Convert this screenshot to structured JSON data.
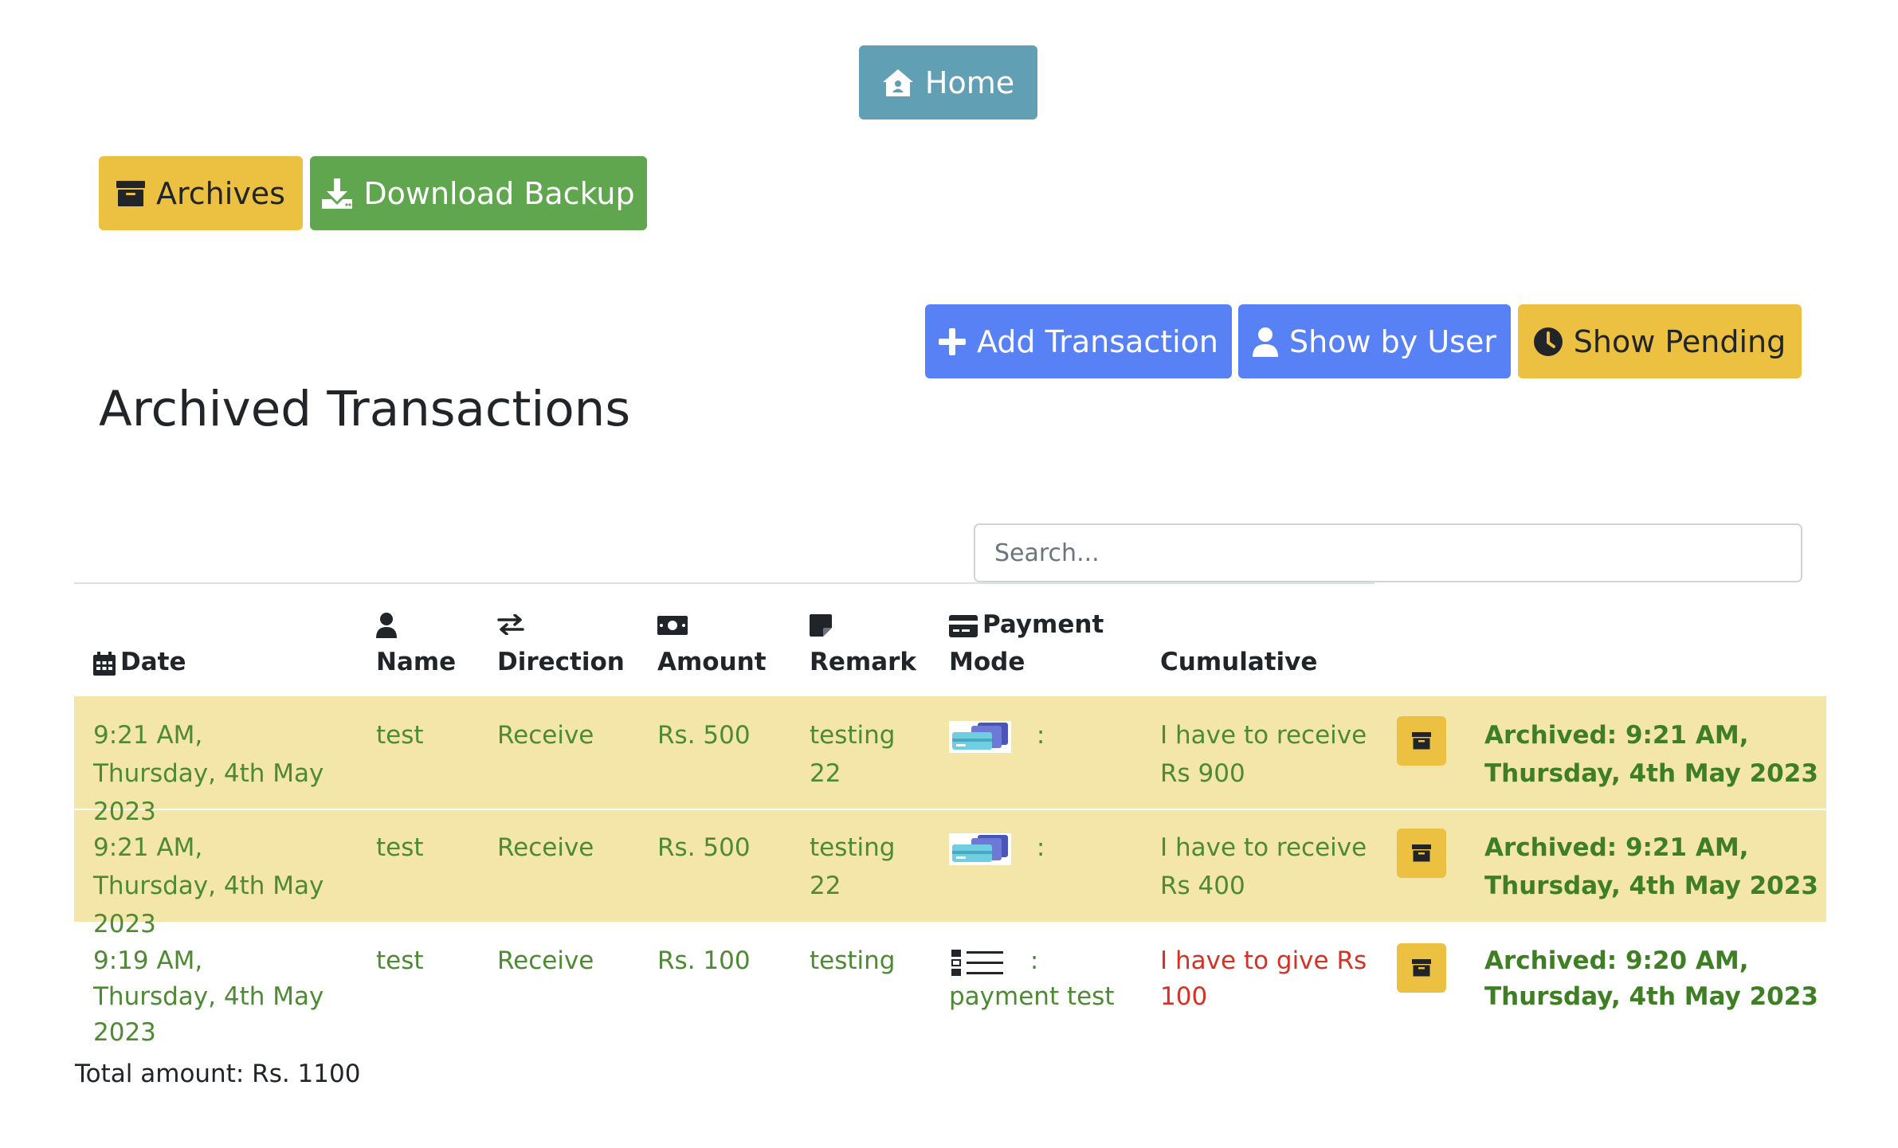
{
  "nav": {
    "home_label": "Home"
  },
  "top_actions": {
    "archives_label": "Archives",
    "backup_label": "Download Backup"
  },
  "actions": {
    "add_label": "Add Transaction",
    "by_user_label": "Show by User",
    "pending_label": "Show Pending"
  },
  "page_title": "Archived Transactions",
  "search": {
    "placeholder": "Search..."
  },
  "columns": {
    "date": "Date",
    "name": "Name",
    "direction": "Direction",
    "amount": "Amount",
    "remark": "Remark",
    "payment_mode": "Payment Mode",
    "cumulative": "Cumulative"
  },
  "rows": [
    {
      "date": "9:21 AM, Thursday, 4th May 2023",
      "name": "test",
      "direction": "Receive",
      "amount": "Rs. 500",
      "remark": "testing 22",
      "payment_icon": "card-icon",
      "payment_sep": ":",
      "payment_note": "",
      "cumulative": "I have to receive Rs 900",
      "cumulative_color": "#4e8a34",
      "archived": "Archived: 9:21 AM, Thursday, 4th May 2023"
    },
    {
      "date": "9:21 AM, Thursday, 4th May 2023",
      "name": "test",
      "direction": "Receive",
      "amount": "Rs. 500",
      "remark": "testing 22",
      "payment_icon": "card-icon",
      "payment_sep": ":",
      "payment_note": "",
      "cumulative": "I have to receive Rs 400",
      "cumulative_color": "#4e8a34",
      "archived": "Archived: 9:21 AM, Thursday, 4th May 2023"
    },
    {
      "date": "9:19 AM, Thursday, 4th May 2023",
      "name": "test",
      "direction": "Receive",
      "amount": "Rs. 100",
      "remark": "testing",
      "payment_icon": "list-icon",
      "payment_sep": ":",
      "payment_note": "payment test",
      "cumulative": "I have to give Rs 100",
      "cumulative_color": "#d33327",
      "archived": "Archived: 9:20 AM, Thursday, 4th May 2023"
    }
  ],
  "total": "Total amount: Rs. 1100",
  "colors": {
    "info": "#61a0b4",
    "warning": "#ecc141",
    "success": "#5fa64e",
    "primary": "#5881f6",
    "row_highlight": "#f3e6a8"
  }
}
